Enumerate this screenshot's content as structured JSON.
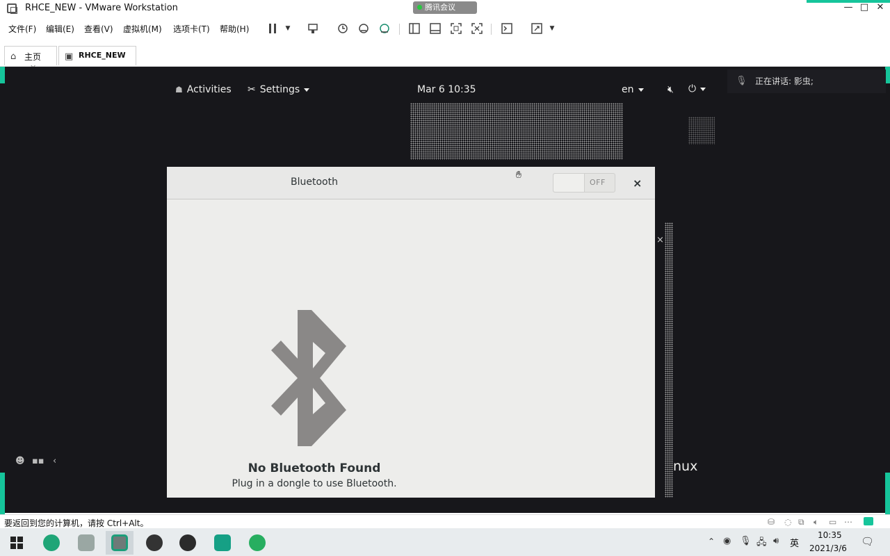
{
  "window": {
    "title": "RHCE_NEW - VMware Workstation",
    "meeting_badge": "腾讯会议",
    "minimize": "—",
    "maximize": "□",
    "close": "✕"
  },
  "menu": {
    "items": [
      "文件(F)",
      "编辑(E)",
      "查看(V)",
      "虚拟机(M)",
      "选项卡(T)",
      "帮助(H)"
    ]
  },
  "tabs": [
    {
      "label": "主页",
      "close": "✕"
    },
    {
      "label": "RHCE_NEW"
    }
  ],
  "gnome": {
    "activities": "Activities",
    "settings": "Settings",
    "clock": "Mar 6  10:35",
    "lang": "en"
  },
  "meeting": {
    "speaking": "正在讲话: 影虫;"
  },
  "dialog": {
    "title": "Bluetooth",
    "toggle": {
      "label": "OFF",
      "on": false
    },
    "close": "×",
    "empty_title": "No Bluetooth Found",
    "empty_subtitle": "Plug in a dongle to use Bluetooth."
  },
  "background_text": "nux",
  "side_close": "×",
  "left_tools": {
    "collapse": "‹"
  },
  "status": {
    "text": "要返回到您的计算机，请按 Ctrl+Alt。"
  },
  "tray": {
    "ime": "英",
    "time": "10:35",
    "date": "2021/3/6"
  },
  "colors": {
    "accent": "#16c59b",
    "guest_bg": "#17171b",
    "dialog_bg": "#ededeb",
    "bt_icon": "#8a8887"
  }
}
